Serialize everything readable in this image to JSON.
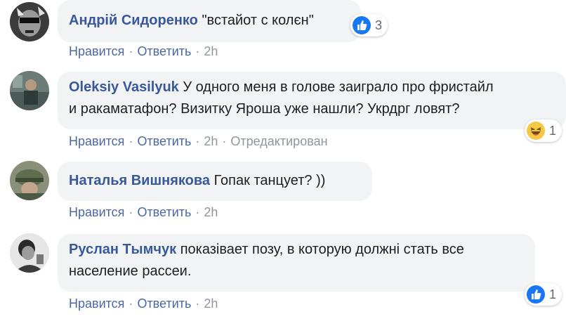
{
  "colors": {
    "name": "#385898",
    "action": "#4b67a1",
    "meta": "#90949c",
    "bubble": "#f2f3f5",
    "like": "#1877f2"
  },
  "comments": [
    {
      "author": "Андрій Сидоренко",
      "text": "\"встайот с колєн\"",
      "reaction": {
        "icon": "like-icon",
        "count": "3"
      },
      "actions": {
        "like": "Нравится",
        "reply": "Ответить",
        "time": "2h"
      }
    },
    {
      "author": "Oleksiy Vasilyuk",
      "text_line1": "У одного меня в голове заиграло про фристайл",
      "text_line2": "и ракаматафон? Визитку Яроша уже нашли? Укрдрг ловят?",
      "reaction": {
        "icon": "haha-icon",
        "count": "1"
      },
      "actions": {
        "like": "Нравится",
        "reply": "Ответить",
        "time": "2h",
        "edited": "Отредактирован"
      }
    },
    {
      "author": "Наталья Вишнякова",
      "text": "Гопак танцует? ))",
      "actions": {
        "like": "Нравится",
        "reply": "Ответить",
        "time": "2h"
      }
    },
    {
      "author": "Руслан Тымчук",
      "text_line1": "показівает позу, в которую должні стать все",
      "text_line2": "население рассеи.",
      "reaction": {
        "icon": "like-icon",
        "count": "1"
      },
      "actions": {
        "like": "Нравится",
        "reply": "Ответить",
        "time": "2h"
      }
    }
  ]
}
